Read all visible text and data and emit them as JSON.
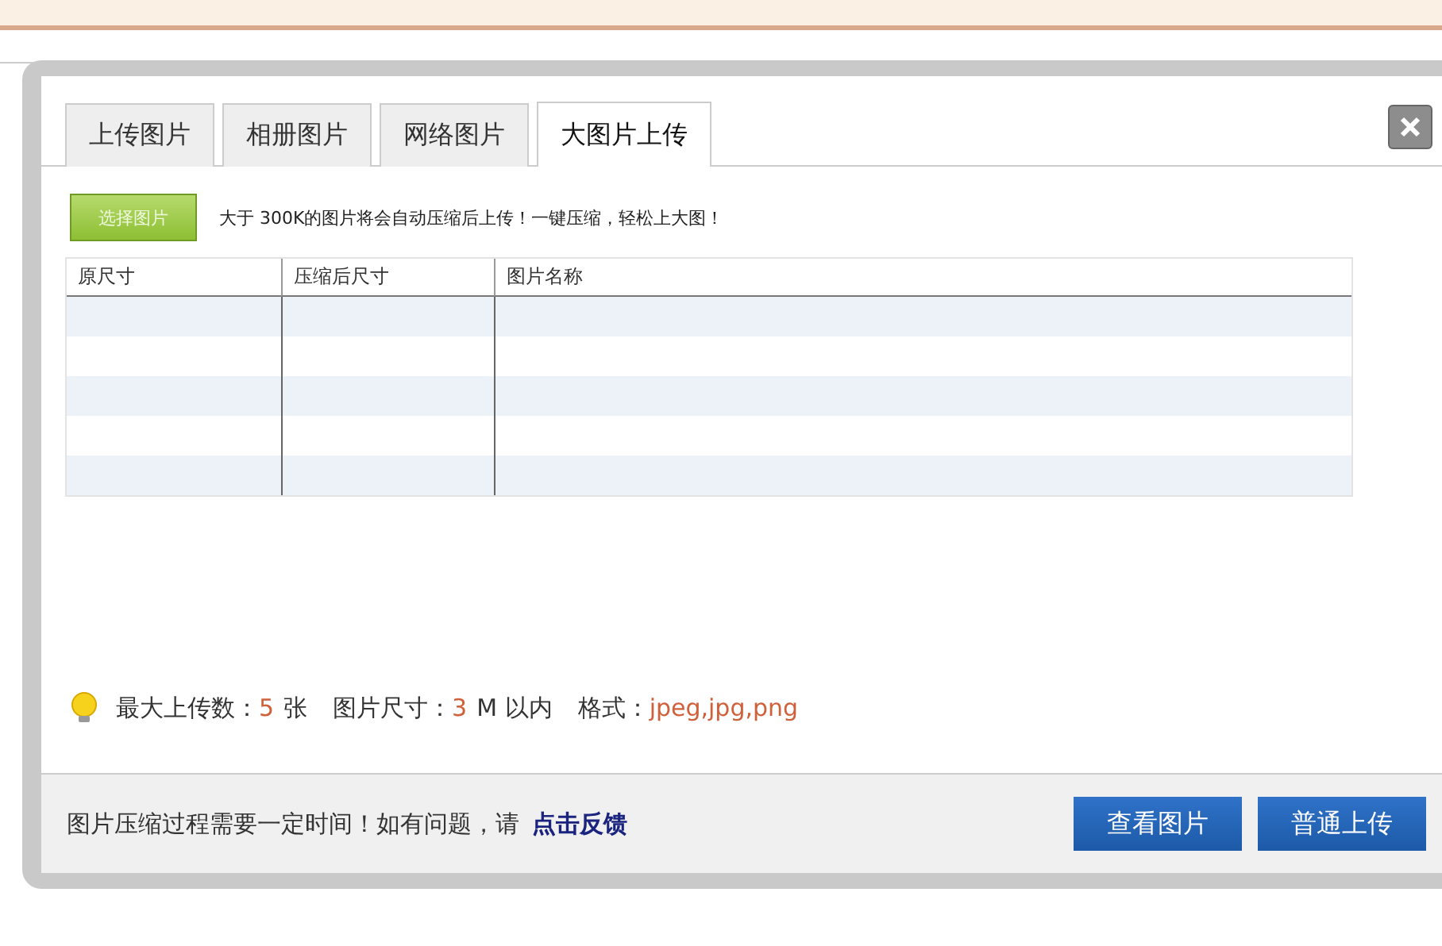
{
  "dialog": {
    "tabs": [
      {
        "label": "上传图片",
        "selected": false
      },
      {
        "label": "相册图片",
        "selected": false
      },
      {
        "label": "网络图片",
        "selected": false
      },
      {
        "label": "大图片上传",
        "selected": true
      }
    ],
    "select_button": "选择图片",
    "hint": "大于 300K的图片将会自动压缩后上传！一键压缩，轻松上大图！",
    "table": {
      "columns": [
        "原尺寸",
        "压缩后尺寸",
        "图片名称"
      ]
    },
    "limits": [
      {
        "label": "最大上传数：",
        "value": "5",
        "unit": "张"
      },
      {
        "label": "图片尺寸：",
        "value": "3",
        "unit": "M 以内"
      },
      {
        "label": "格式：",
        "value": "jpeg,jpg,png"
      }
    ],
    "footer": {
      "note": "图片压缩过程需要一定时间！如有问题，请",
      "link": "点击反馈",
      "buttons": [
        "查看图片",
        "普通上传"
      ]
    }
  }
}
